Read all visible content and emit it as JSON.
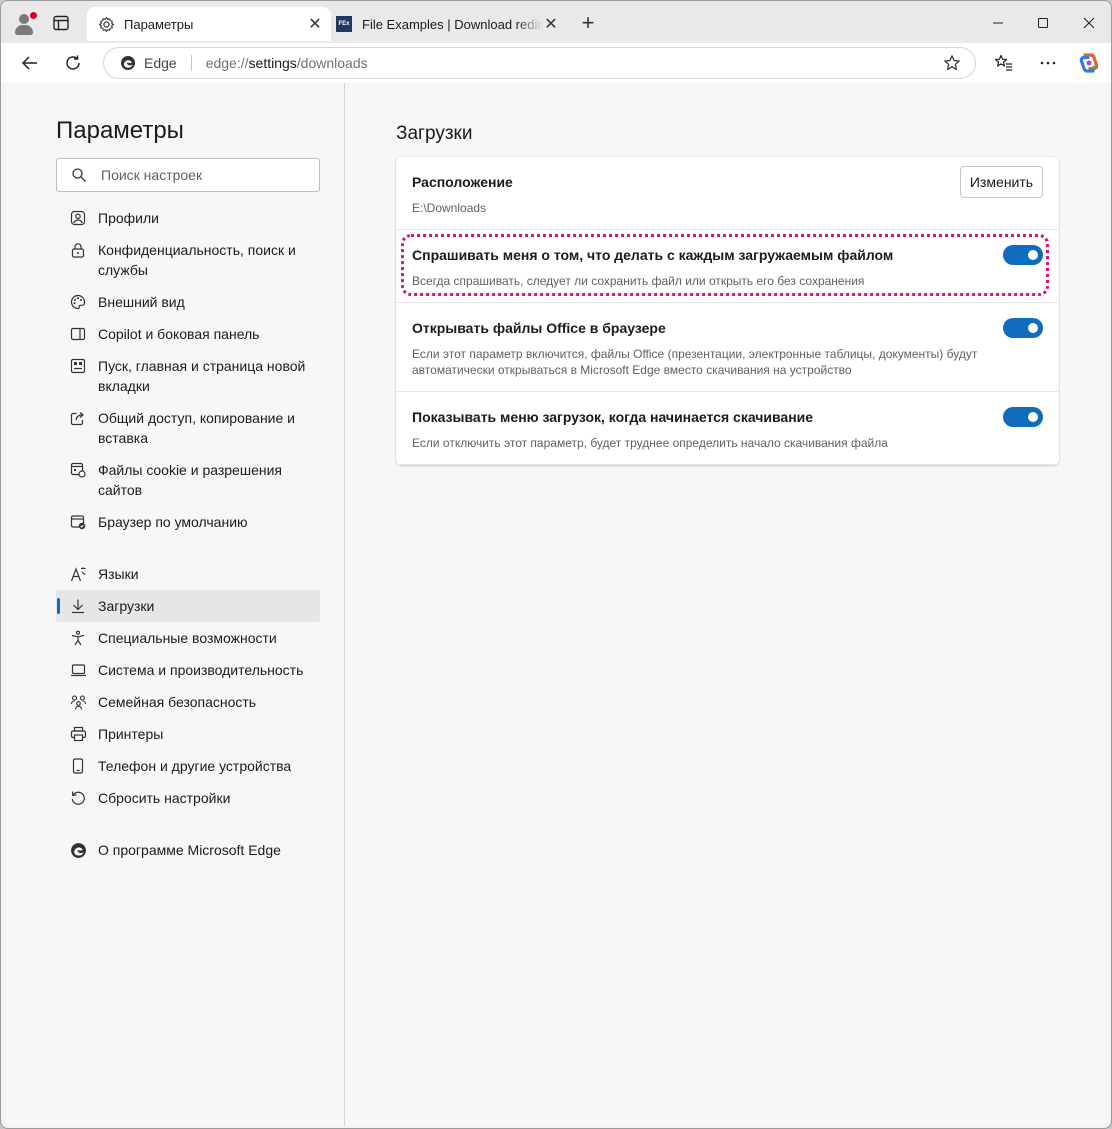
{
  "browser": {
    "tabs": [
      {
        "title": "Параметры",
        "icon": "gear-icon",
        "active": true
      },
      {
        "title": "File Examples | Download redirect",
        "icon": "fex-favicon",
        "favicon_text": "FEx",
        "active": false
      }
    ],
    "address": {
      "site_name": "Edge",
      "url_prefix": "edge://",
      "url_main": "settings",
      "url_suffix": "/downloads"
    }
  },
  "sidebar": {
    "title": "Параметры",
    "search_placeholder": "Поиск настроек",
    "items": [
      {
        "label": "Профили",
        "icon": "profile-icon"
      },
      {
        "label": "Конфиденциальность, поиск и службы",
        "icon": "lock-icon"
      },
      {
        "label": "Внешний вид",
        "icon": "palette-icon"
      },
      {
        "label": "Copilot и боковая панель",
        "icon": "sidebar-icon"
      },
      {
        "label": "Пуск, главная и страница новой вкладки",
        "icon": "home-grid-icon"
      },
      {
        "label": "Общий доступ, копирование и вставка",
        "icon": "share-icon"
      },
      {
        "label": "Файлы cookie и разрешения сайтов",
        "icon": "cookie-icon"
      },
      {
        "label": "Браузер по умолчанию",
        "icon": "default-browser-icon"
      },
      {
        "label": "Языки",
        "icon": "language-icon"
      },
      {
        "label": "Загрузки",
        "icon": "download-icon",
        "selected": true
      },
      {
        "label": "Специальные возможности",
        "icon": "accessibility-icon"
      },
      {
        "label": "Система и производительность",
        "icon": "laptop-icon"
      },
      {
        "label": "Семейная безопасность",
        "icon": "family-icon"
      },
      {
        "label": "Принтеры",
        "icon": "printer-icon"
      },
      {
        "label": "Телефон и другие устройства",
        "icon": "phone-icon"
      },
      {
        "label": "Сбросить настройки",
        "icon": "reset-icon"
      },
      {
        "label": "О программе Microsoft Edge",
        "icon": "edge-logo-icon"
      }
    ]
  },
  "main": {
    "title": "Загрузки",
    "location": {
      "title": "Расположение",
      "path": "E:\\Downloads",
      "button": "Изменить"
    },
    "settings": [
      {
        "title": "Спрашивать меня о том, что делать с каждым загружаемым файлом",
        "description": "Всегда спрашивать, следует ли сохранить файл или открыть его без сохранения",
        "enabled": true,
        "highlighted": true
      },
      {
        "title": "Открывать файлы Office в браузере",
        "description": "Если этот параметр включится, файлы Office (презентации, электронные таблицы, документы) будут автоматически открываться в Microsoft Edge вместо скачивания на устройство",
        "enabled": true
      },
      {
        "title": "Показывать меню загрузок, когда начинается скачивание",
        "description": "Если отключить этот параметр, будет труднее определить начало скачивания файла",
        "enabled": true
      }
    ]
  },
  "colors": {
    "accent": "#0f6cbd",
    "highlight": "#d4147a"
  }
}
